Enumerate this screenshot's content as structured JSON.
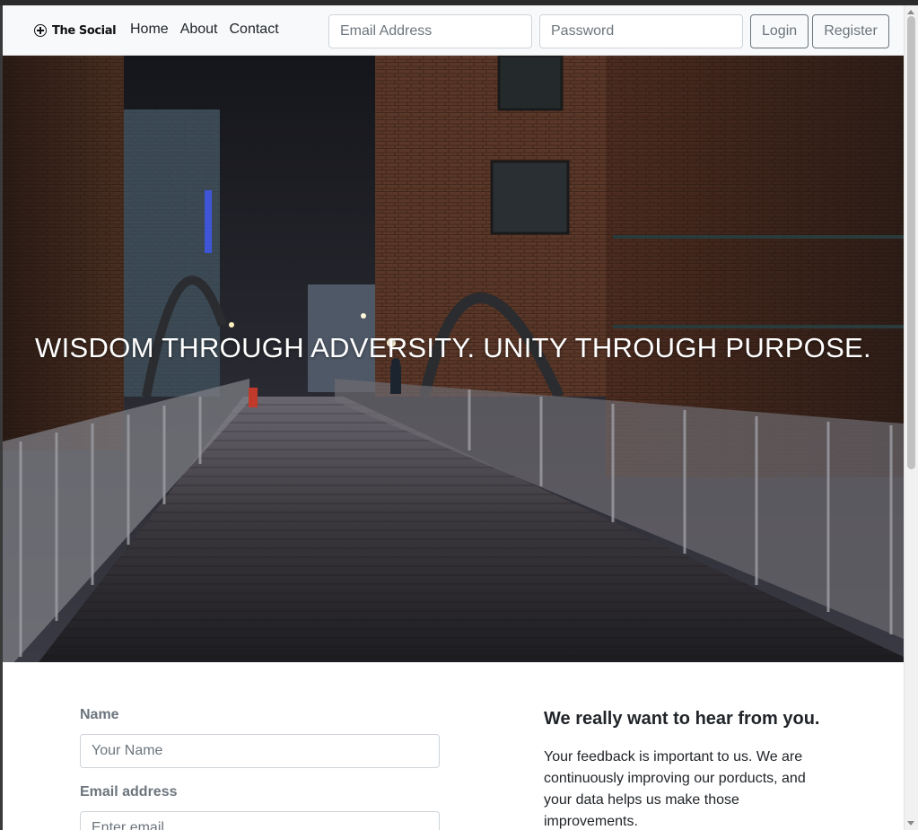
{
  "navbar": {
    "brand": "The Social",
    "links": [
      "Home",
      "About",
      "Contact"
    ],
    "email_placeholder": "Email Address",
    "password_placeholder": "Password",
    "login_label": "Login",
    "register_label": "Register"
  },
  "hero": {
    "tagline": "WISDOM THROUGH ADVERSITY. UNITY THROUGH PURPOSE."
  },
  "form": {
    "name_label": "Name",
    "name_placeholder": "Your Name",
    "email_label": "Email address",
    "email_placeholder": "Enter email"
  },
  "info": {
    "title": "We really want to hear from you.",
    "body": "Your feedback is important to us. We are continuously improving our porducts, and your data helps us make those improvements."
  }
}
